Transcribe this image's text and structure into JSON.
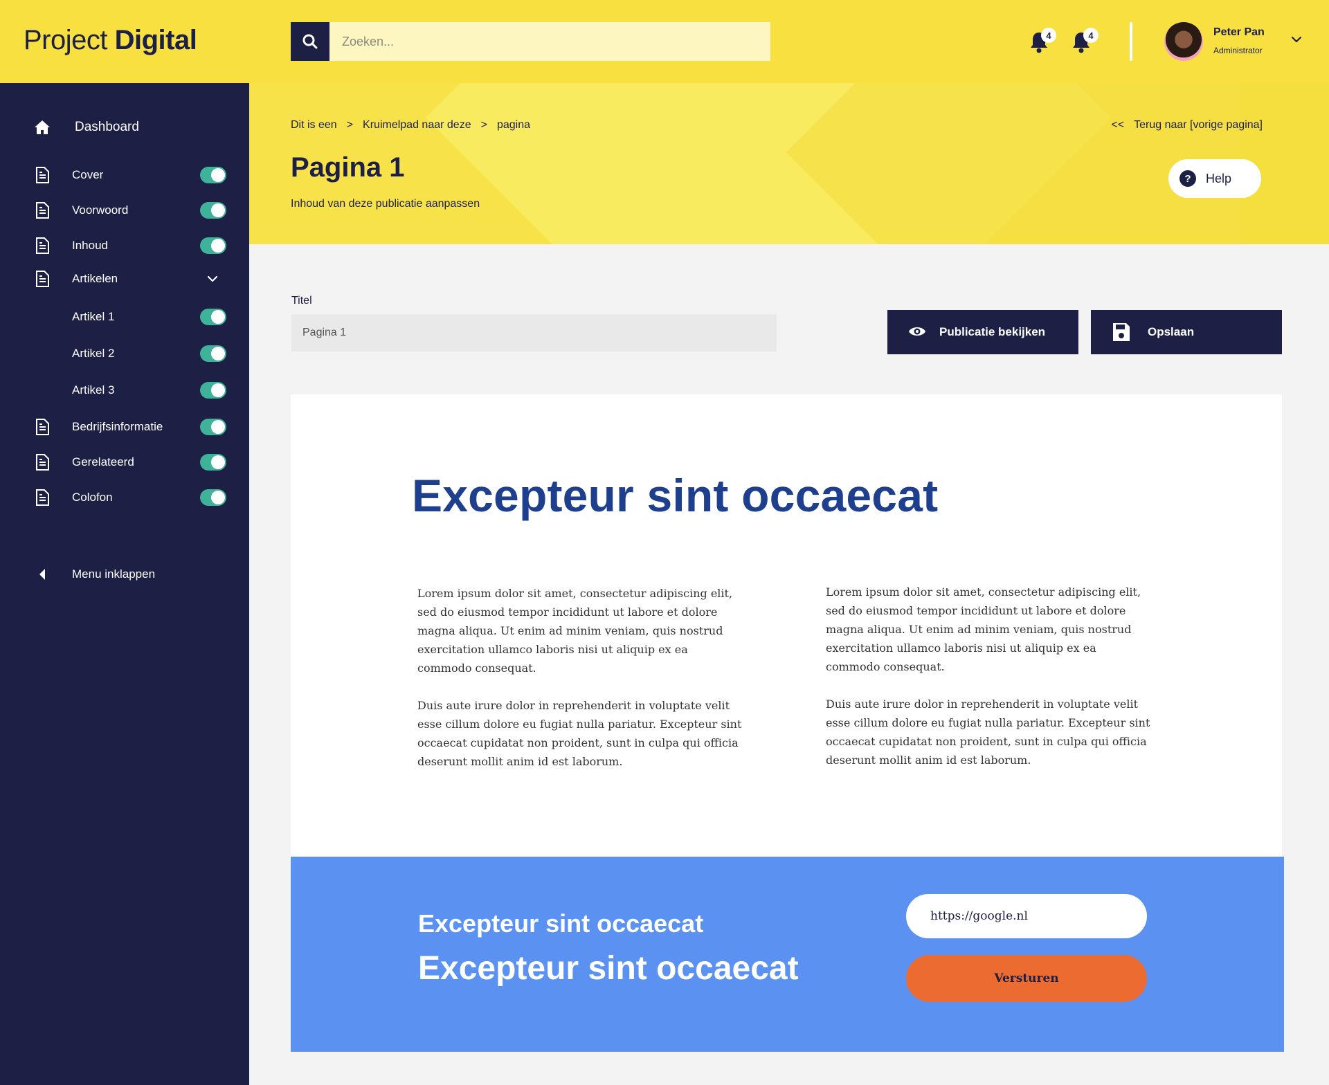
{
  "app": {
    "logo_light": "Project ",
    "logo_bold": "Digital"
  },
  "search": {
    "placeholder": "Zoeken...",
    "icon": "search-icon"
  },
  "notifications": [
    {
      "icon": "bell-icon",
      "count": "4"
    },
    {
      "icon": "bell-icon",
      "count": "4"
    }
  ],
  "user": {
    "name": "Peter Pan",
    "role": "Administrator"
  },
  "sidebar": {
    "dashboard": "Dashboard",
    "items": [
      {
        "label": "Cover",
        "enabled": true
      },
      {
        "label": "Voorwoord",
        "enabled": true
      },
      {
        "label": "Inhoud",
        "enabled": true
      },
      {
        "label": "Artikelen",
        "expanded": true
      },
      {
        "label": "Artikel 1",
        "enabled": true
      },
      {
        "label": "Artikel 2",
        "enabled": true
      },
      {
        "label": "Artikel 3",
        "enabled": true
      },
      {
        "label": "Bedrijfsinformatie",
        "enabled": true
      },
      {
        "label": "Gerelateerd",
        "enabled": true
      },
      {
        "label": "Colofon",
        "enabled": true
      }
    ],
    "collapse": "Menu inklappen"
  },
  "hero": {
    "breadcrumb": [
      "Dit is een",
      "Kruimelpad naar deze",
      "pagina"
    ],
    "breadcrumb_sep": ">",
    "back_arrow": "<<",
    "back_label": "Terug naar [vorige pagina]",
    "title": "Pagina 1",
    "subtitle": "Inhoud van deze publicatie aanpassen",
    "help_label": "Help"
  },
  "form": {
    "title_label": "Titel",
    "title_value": "Pagina 1",
    "view_button": "Publicatie bekijken",
    "save_button": "Opslaan"
  },
  "content": {
    "heading": "Excepteur sint occaecat",
    "columns": [
      {
        "p1": "Lorem ipsum dolor sit amet, consectetur adipiscing elit, sed do eiusmod tempor incididunt ut labore et dolore magna aliqua. Ut enim ad minim veniam, quis nostrud exercitation ullamco laboris nisi ut aliquip ex ea commodo consequat.",
        "p2": "Duis aute irure dolor in reprehenderit in voluptate velit esse cillum dolore eu fugiat nulla pariatur. Excepteur sint occaecat cupidatat non proident, sunt in culpa qui officia deserunt mollit anim id est laborum."
      },
      {
        "p1": "Lorem ipsum dolor sit amet, consectetur adipiscing elit, sed do eiusmod tempor incididunt ut labore et dolore magna aliqua. Ut enim ad minim veniam, quis nostrud exercitation ullamco laboris nisi ut aliquip ex ea commodo consequat.",
        "p2": "Duis aute irure dolor in reprehenderit in voluptate velit esse cillum dolore eu fugiat nulla pariatur. Excepteur sint occaecat cupidatat non proident, sunt in culpa qui officia deserunt mollit anim id est laborum."
      }
    ]
  },
  "cta": {
    "heading_small": "Excepteur sint occaecat",
    "heading_large": "Excepteur sint occaecat",
    "url_value": "https://google.nl",
    "submit_label": "Versturen"
  },
  "colors": {
    "navy": "#1e1f45",
    "yellow": "#f7e040",
    "toggle_green": "#3fb39a",
    "heading_blue": "#1d3f8e",
    "cta_blue": "#5b92f2",
    "cta_orange": "#ec6b30"
  }
}
